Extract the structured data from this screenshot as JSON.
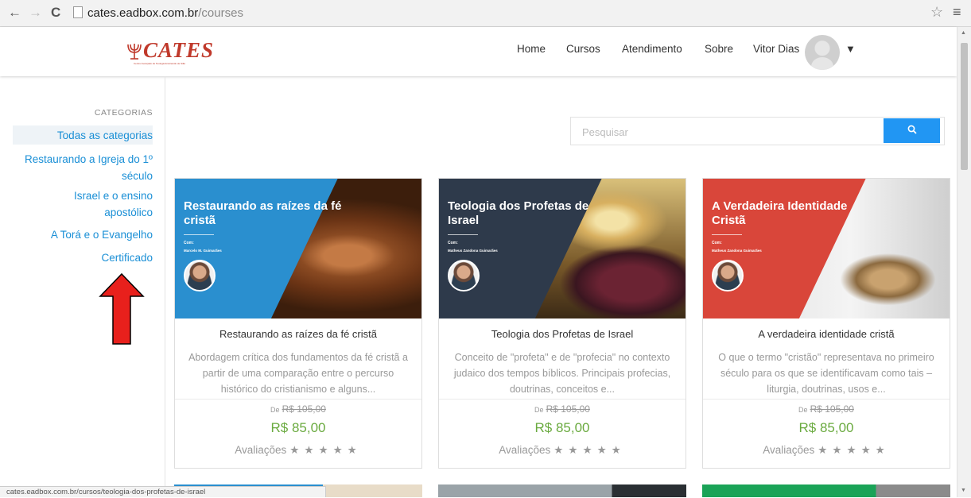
{
  "browser": {
    "url_host": "cates.eadbox.com.br",
    "url_path": "/courses",
    "back": "←",
    "forward": "→",
    "reload": "C",
    "star": "☆",
    "menu": "≡"
  },
  "header": {
    "logo_text": "CATES",
    "logo_subtitle": "Centro Avançado de Teologia Ensinando de Sião",
    "nav": [
      "Home",
      "Cursos",
      "Atendimento",
      "Sobre",
      "Vitor Dias"
    ]
  },
  "sidebar": {
    "title": "CATEGORIAS",
    "items": [
      {
        "label": "Todas as categorias"
      },
      {
        "label": "Restaurando a Igreja do 1º século"
      },
      {
        "label": "Israel e o ensino apostólico"
      },
      {
        "label": "A Torá e o Evangelho"
      },
      {
        "label": "Certificado"
      }
    ]
  },
  "search": {
    "placeholder": "Pesquisar",
    "button_icon": "search-icon"
  },
  "courses": [
    {
      "banner_title": "Restaurando as raízes da fé cristã",
      "banner_with": "Com:",
      "banner_author": "Marcelo M. Guimarães",
      "title": "Restaurando as raízes da fé cristã",
      "description": "Abordagem crítica dos fundamentos da fé cristã a partir de uma comparação entre o percurso histórico do cristianismo e alguns...",
      "old_label": "De",
      "old_price": "R$ 105,00",
      "price": "R$ 85,00",
      "rating_label": "Avaliações",
      "stars": "★★★★★",
      "accent": "#2a8fcf"
    },
    {
      "banner_title": "Teologia dos Profetas de Israel",
      "banner_with": "Com:",
      "banner_author": "Matheus Zandona Guimarães",
      "title": "Teologia dos Profetas de Israel",
      "description": "Conceito de \"profeta\" e de \"profecia\" no contexto judaico dos tempos bíblicos. Principais profecias, doutrinas, conceitos e...",
      "old_label": "De",
      "old_price": "R$ 105,00",
      "price": "R$ 85,00",
      "rating_label": "Avaliações",
      "stars": "★★★★★",
      "accent": "#2e3a4b"
    },
    {
      "banner_title": "A Verdadeira Identidade Cristã",
      "banner_with": "Com:",
      "banner_author": "Matheus Zandona Guimarães",
      "title": "A verdadeira identidade cristã",
      "description": "O que o termo \"cristão\" representava no primeiro século para os que se identificavam como tais – liturgia, doutrinas, usos e...",
      "old_label": "De",
      "old_price": "R$ 105,00",
      "price": "R$ 85,00",
      "rating_label": "Avaliações",
      "stars": "★★★★★",
      "accent": "#d9463a"
    }
  ],
  "status_bar": "cates.eadbox.com.br/cursos/teologia-dos-profetas-de-israel",
  "colors": {
    "link": "#1a8fd6",
    "price": "#6aaa3f",
    "search_button": "#2196f3",
    "annotation_arrow": "#e8201c"
  }
}
